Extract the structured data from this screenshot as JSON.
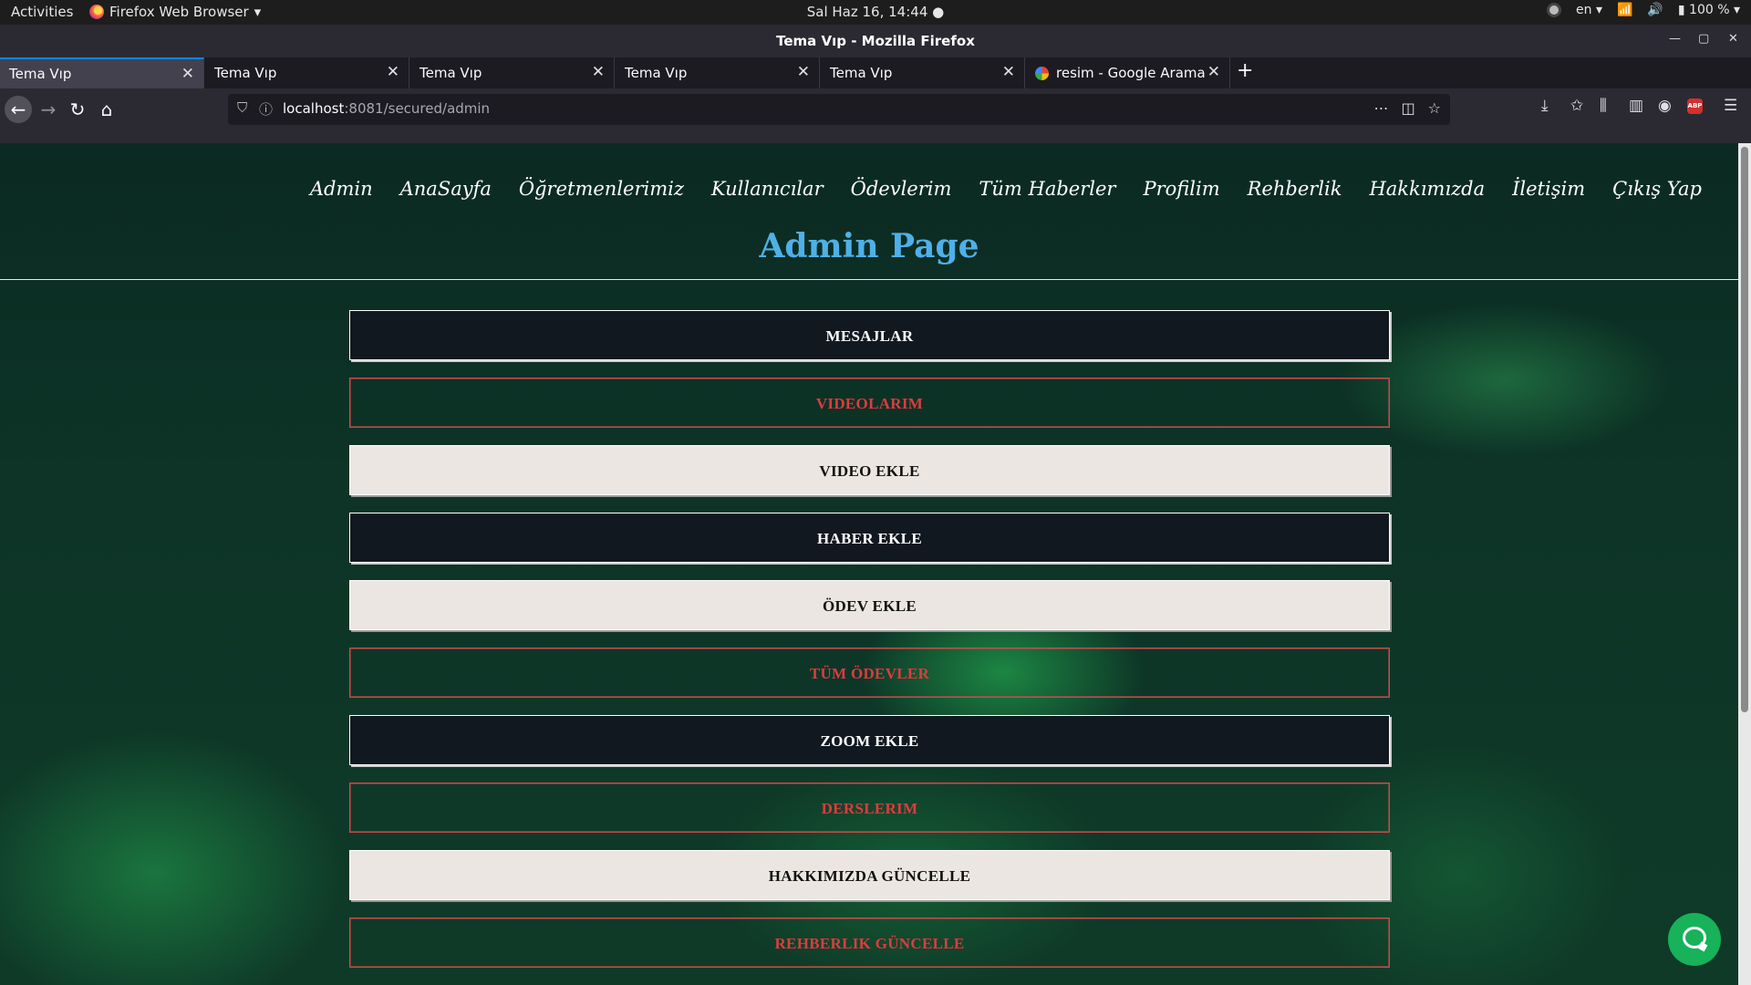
{
  "system_bar": {
    "activities": "Activities",
    "app_name": "Firefox Web Browser",
    "clock": "Sal Haz 16, 14:44",
    "lang": "en",
    "battery": "100 %"
  },
  "window": {
    "title": "Tema Vıp - Mozilla Firefox"
  },
  "tabs": [
    {
      "label": "Tema Vıp"
    },
    {
      "label": "Tema Vıp"
    },
    {
      "label": "Tema Vıp"
    },
    {
      "label": "Tema Vıp"
    },
    {
      "label": "Tema Vıp"
    },
    {
      "label": "resim - Google Arama"
    }
  ],
  "url": {
    "host": "localhost",
    "rest": ":8081/secured/admin"
  },
  "site": {
    "nav": [
      "Admin",
      "AnaSayfa",
      "Öğretmenlerimiz",
      "Kullanıcılar",
      "Ödevlerim",
      "Tüm Haberler",
      "Profilim",
      "Rehberlik",
      "Hakkımızda",
      "İletişim",
      "Çıkış Yap"
    ],
    "title": "Admin Page",
    "buttons": [
      {
        "label": "MESAJLAR",
        "style": "dark"
      },
      {
        "label": "VIDEOLARIM",
        "style": "red"
      },
      {
        "label": "VIDEO EKLE",
        "style": "light"
      },
      {
        "label": "HABER EKLE",
        "style": "dark"
      },
      {
        "label": "ÖDEV EKLE",
        "style": "light"
      },
      {
        "label": "TÜM ÖDEVLER",
        "style": "red"
      },
      {
        "label": "ZOOM EKLE",
        "style": "dark"
      },
      {
        "label": "DERSLERIM",
        "style": "red"
      },
      {
        "label": "HAKKIMIZDA GÜNCELLE",
        "style": "light"
      },
      {
        "label": "REHBERLIK GÜNCELLE",
        "style": "red"
      }
    ]
  },
  "colors": {
    "title_blue": "#4fb0e8",
    "red_text": "#e03a3e",
    "dark_btn": "#111820",
    "light_btn": "#ebe6e1",
    "chat_green": "#17b25a"
  }
}
